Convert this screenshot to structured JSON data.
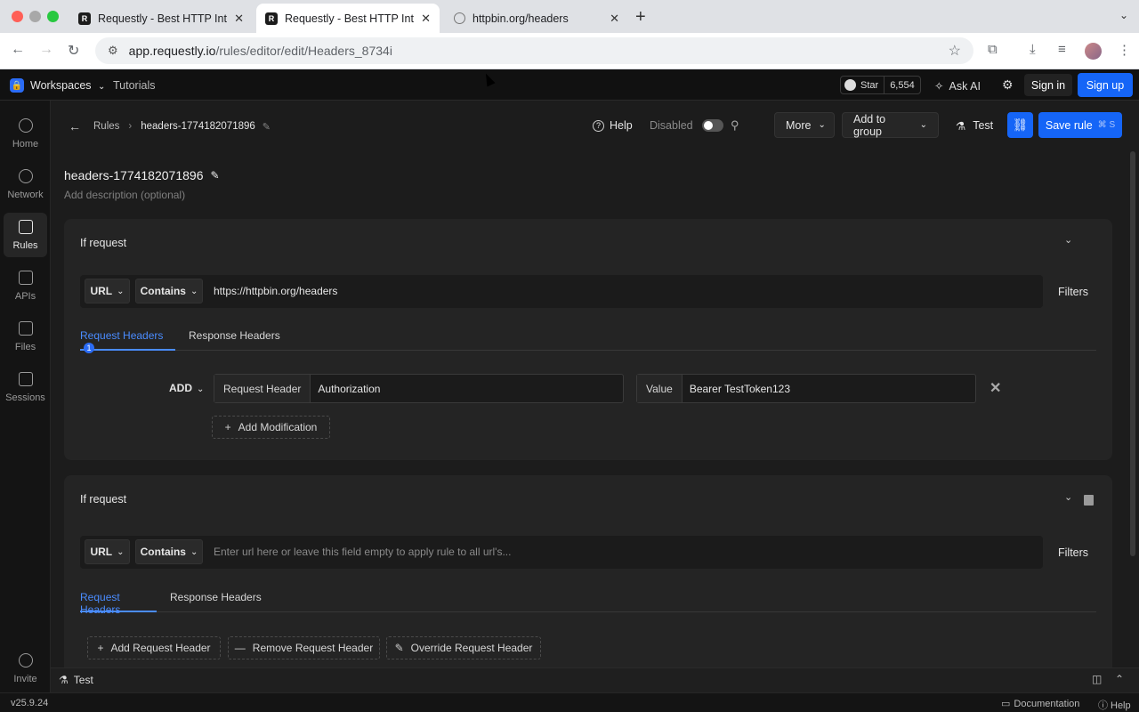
{
  "browser": {
    "tabs": [
      {
        "title": "Requestly - Best HTTP Interc",
        "active": false
      },
      {
        "title": "Requestly - Best HTTP Interc",
        "active": true
      },
      {
        "title": "httpbin.org/headers",
        "active": false
      }
    ],
    "url_host": "app.requestly.io",
    "url_path": "/rules/editor/edit/Headers_8734i"
  },
  "header": {
    "workspaces": "Workspaces",
    "tutorials": "Tutorials",
    "star_label": "Star",
    "star_count": "6,554",
    "ask_ai": "Ask AI",
    "sign_in": "Sign in",
    "sign_up": "Sign up"
  },
  "sidebar": {
    "items": [
      {
        "label": "Home",
        "icon": "home-icon"
      },
      {
        "label": "Network",
        "icon": "globe-icon"
      },
      {
        "label": "Rules",
        "icon": "rules-icon",
        "active": true
      },
      {
        "label": "APIs",
        "icon": "api-icon"
      },
      {
        "label": "Files",
        "icon": "file-icon"
      },
      {
        "label": "Sessions",
        "icon": "sessions-icon"
      }
    ],
    "invite": "Invite",
    "version": "v25.9.24"
  },
  "editor": {
    "breadcrumb_root": "Rules",
    "breadcrumb_current": "headers-1774182071896",
    "help": "Help",
    "status": "Disabled",
    "more": "More",
    "add_to_group": "Add to group",
    "test": "Test",
    "save": "Save rule",
    "save_shortcut": "⌘ S",
    "rule_name": "headers-1774182071896",
    "description_placeholder": "Add description (optional)"
  },
  "pair1": {
    "title": "If request",
    "source_key": "URL",
    "operator": "Contains",
    "url": "https://httpbin.org/headers",
    "filters": "Filters",
    "tab_request": "Request Headers",
    "tab_request_count": "1",
    "tab_response": "Response Headers",
    "modification": {
      "type": "ADD",
      "header_label": "Request Header",
      "header_value": "Authorization",
      "value_label": "Value",
      "value": "Bearer TestToken123"
    },
    "add_modification": "Add Modification"
  },
  "pair2": {
    "title": "If request",
    "source_key": "URL",
    "operator": "Contains",
    "url_placeholder": "Enter url here or leave this field empty to apply rule to all url's...",
    "filters": "Filters",
    "tab_request": "Request Headers",
    "tab_response": "Response Headers",
    "add_header": "Add Request Header",
    "remove_header": "Remove Request Header",
    "override_header": "Override Request Header"
  },
  "footer": {
    "test": "Test",
    "documentation": "Documentation",
    "help": "Help"
  },
  "colors": {
    "accent": "#1565f7",
    "active_tab": "#4a8cff",
    "background": "#1c1c1c"
  }
}
